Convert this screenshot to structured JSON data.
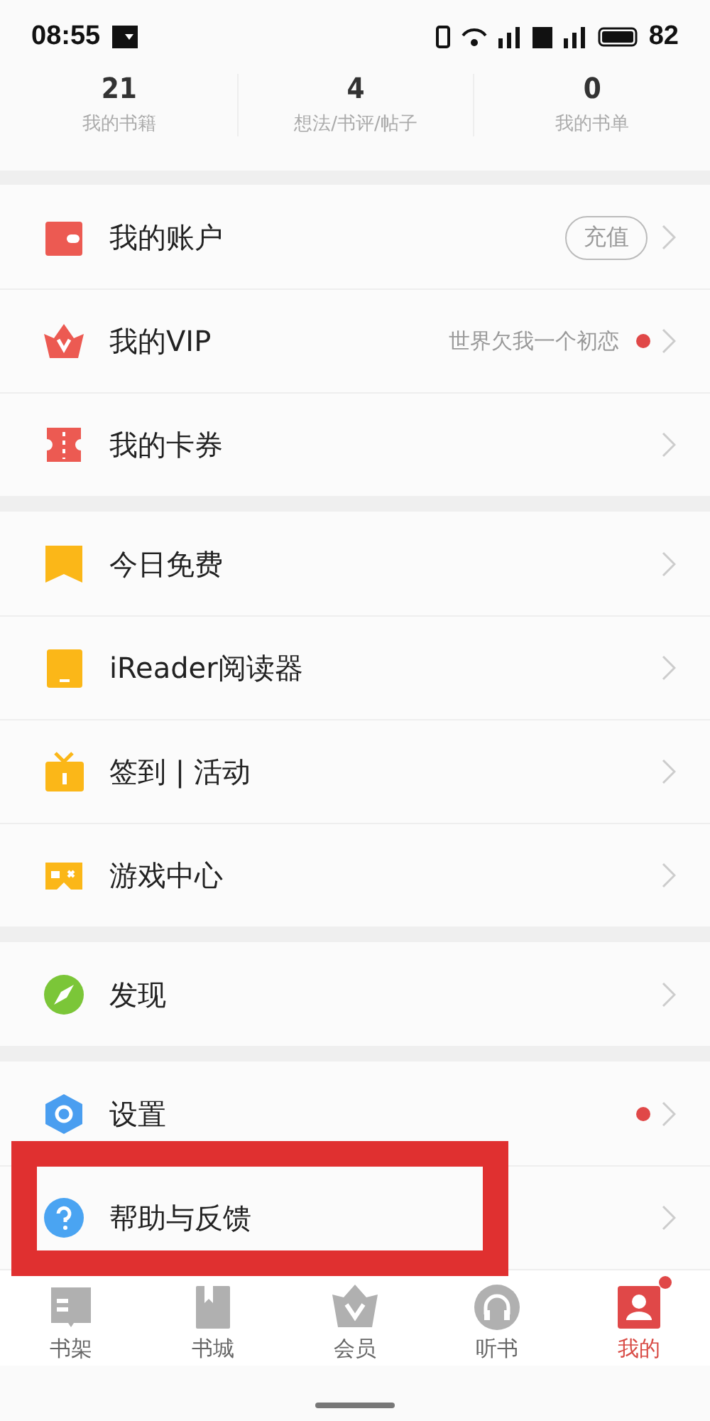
{
  "status_bar": {
    "time": "08:55",
    "battery": "82"
  },
  "stats": [
    {
      "value": "21",
      "label": "我的书籍"
    },
    {
      "value": "4",
      "label": "想法/书评/帖子"
    },
    {
      "value": "0",
      "label": "我的书单"
    }
  ],
  "groups": [
    {
      "items": [
        {
          "kind": "wallet",
          "label": "我的账户",
          "action": "充值"
        },
        {
          "kind": "crown",
          "label": "我的VIP",
          "note": "世界欠我一个初恋",
          "dot": true
        },
        {
          "kind": "ticket",
          "label": "我的卡券"
        }
      ]
    },
    {
      "items": [
        {
          "kind": "bookmark",
          "label": "今日免费"
        },
        {
          "kind": "tablet",
          "label": "iReader阅读器"
        },
        {
          "kind": "gift",
          "label": "签到 | 活动"
        },
        {
          "kind": "gamepad",
          "label": "游戏中心"
        }
      ]
    },
    {
      "items": [
        {
          "kind": "compass",
          "label": "发现"
        }
      ]
    },
    {
      "items": [
        {
          "kind": "hexagon",
          "label": "设置",
          "dot": true
        },
        {
          "kind": "question",
          "label": "帮助与反馈",
          "highlighted": true
        }
      ]
    }
  ],
  "tab_bar": [
    {
      "kind": "shelf",
      "label": "书架",
      "selected": false
    },
    {
      "kind": "store",
      "label": "书城",
      "selected": false
    },
    {
      "kind": "member",
      "label": "会员",
      "selected": false
    },
    {
      "kind": "audio",
      "label": "听书",
      "selected": false
    },
    {
      "kind": "profile",
      "label": "我的",
      "selected": true,
      "dot": true
    }
  ]
}
